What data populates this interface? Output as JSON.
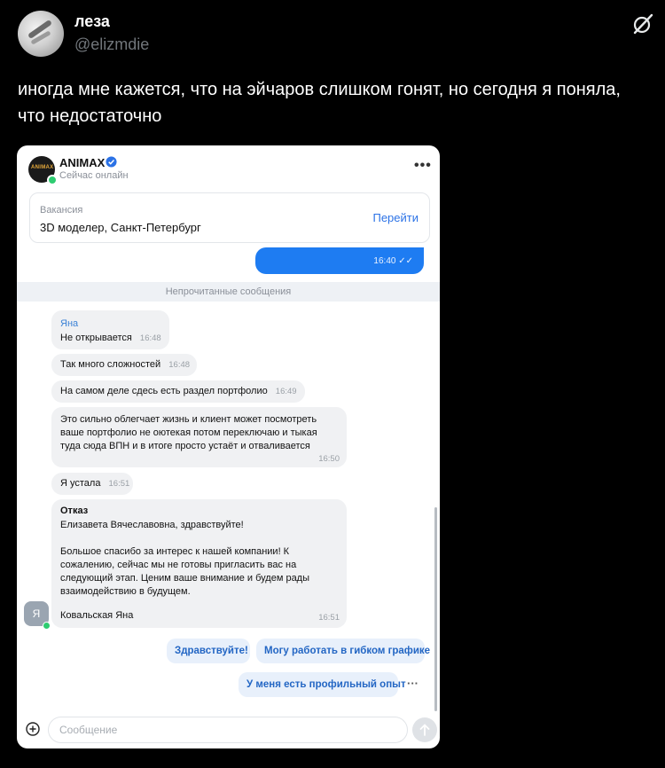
{
  "author": {
    "name": "леза",
    "handle": "@elizmdie"
  },
  "tweet_text": "иногда мне кажется, что на эйчаров слишком гонят, но сегодня я поняла, что недостаточно",
  "chat": {
    "company_name": "ANIMAX",
    "logo_text": "ANIMAX",
    "status": "Сейчас онлайн",
    "menu_icon": "•••",
    "vacancy": {
      "caption": "Вакансия",
      "title": "3D моделер, Санкт-Петербург",
      "action": "Перейти"
    },
    "outgoing_time": "16:40",
    "unread_label": "Непрочитанные сообщения",
    "sender_name": "Яна",
    "messages": [
      {
        "text": "Не открывается",
        "time": "16:48"
      },
      {
        "text": "Так много сложностей",
        "time": "16:48"
      },
      {
        "text": "На самом деле сдесь есть раздел портфолио",
        "time": "16:49"
      },
      {
        "text": "Это сильно облегчает жизнь и клиент может посмотреть ваше портфолио не оютекая потом переключаю и тыкая туда сюда ВПН и в итоге просто устаёт и отваливается",
        "time": "16:50"
      },
      {
        "text": "Я устала",
        "time": "16:51"
      }
    ],
    "rejection": {
      "title": "Отказ",
      "greeting": "Елизавета Вячеславовна, здравствуйте!",
      "body": "Большое спасибо за интерес к нашей компании! К сожалению, сейчас мы не готовы пригласить вас на следующий этап. Ценим ваше внимание и будем рады взаимодействию в будущем.",
      "signature": "Ковальская Яна",
      "time": "16:51"
    },
    "avatar_initial": "Я",
    "quick_replies": [
      "Здравствуйте!",
      "Могу работать в гибком графике",
      "У меня есть профильный опыт"
    ],
    "more_label": "···",
    "input_placeholder": "Сообщение"
  },
  "colors": {
    "accent": "#1e7cf2",
    "link": "#2b72e6",
    "online": "#2ecc71"
  }
}
